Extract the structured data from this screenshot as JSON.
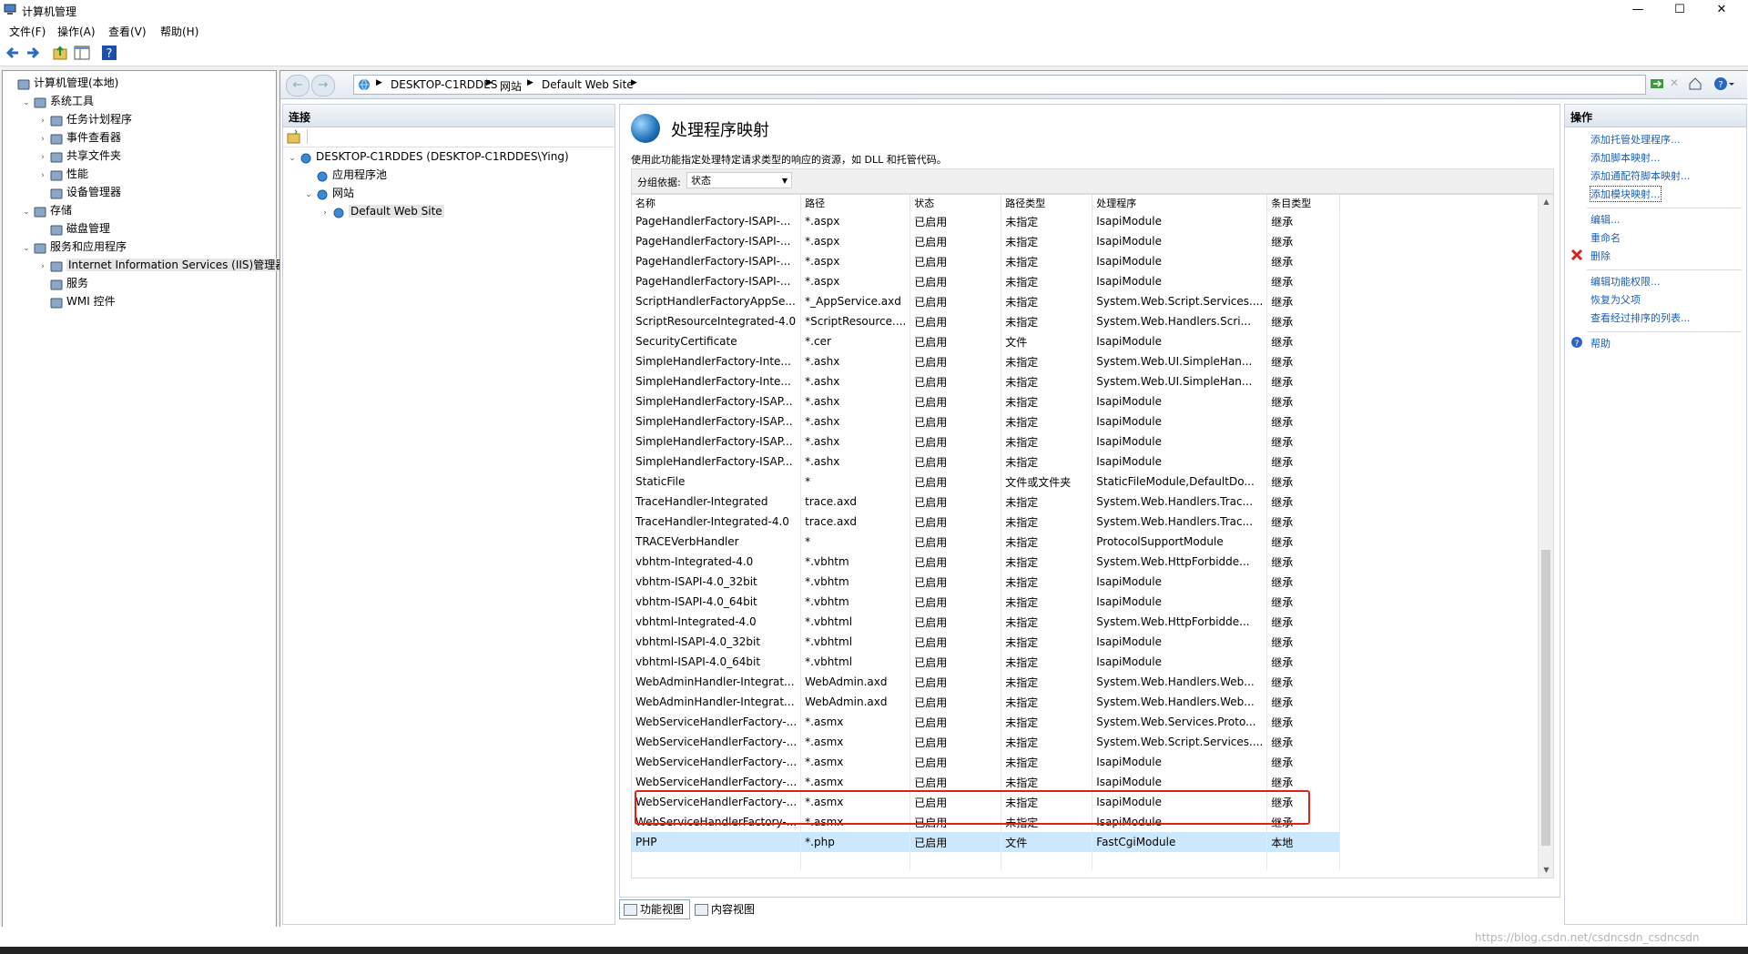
{
  "window": {
    "title": "计算机管理",
    "min": "—",
    "max": "☐",
    "close": "✕"
  },
  "menu": [
    "文件(F)",
    "操作(A)",
    "查看(V)",
    "帮助(H)"
  ],
  "tree": [
    {
      "label": "计算机管理(本地)",
      "indent": 0,
      "tw": "",
      "icon": "computer-icon"
    },
    {
      "label": "系统工具",
      "indent": 1,
      "tw": "⌄",
      "icon": "tools-icon"
    },
    {
      "label": "任务计划程序",
      "indent": 2,
      "tw": "›",
      "icon": "clock-icon"
    },
    {
      "label": "事件查看器",
      "indent": 2,
      "tw": "›",
      "icon": "event-icon"
    },
    {
      "label": "共享文件夹",
      "indent": 2,
      "tw": "›",
      "icon": "folder-icon"
    },
    {
      "label": "性能",
      "indent": 2,
      "tw": "›",
      "icon": "performance-icon"
    },
    {
      "label": "设备管理器",
      "indent": 2,
      "tw": "",
      "icon": "device-icon"
    },
    {
      "label": "存储",
      "indent": 1,
      "tw": "⌄",
      "icon": "storage-icon"
    },
    {
      "label": "磁盘管理",
      "indent": 2,
      "tw": "",
      "icon": "disk-icon"
    },
    {
      "label": "服务和应用程序",
      "indent": 1,
      "tw": "⌄",
      "icon": "services-icon"
    },
    {
      "label": "Internet Information Services (IIS)管理器",
      "indent": 2,
      "tw": "›",
      "icon": "iis-icon",
      "selected": true
    },
    {
      "label": "服务",
      "indent": 2,
      "tw": "",
      "icon": "gear-icon"
    },
    {
      "label": "WMI 控件",
      "indent": 2,
      "tw": "",
      "icon": "wmi-icon"
    }
  ],
  "address": {
    "crumbs": [
      "DESKTOP-C1RDDES",
      "网站",
      "Default Web Site"
    ]
  },
  "connections": {
    "header": "连接",
    "tree": [
      {
        "label": "DESKTOP-C1RDDES (DESKTOP-C1RDDES\\Ying)",
        "indent": 0,
        "tw": "⌄"
      },
      {
        "label": "应用程序池",
        "indent": 1,
        "tw": ""
      },
      {
        "label": "网站",
        "indent": 1,
        "tw": "⌄"
      },
      {
        "label": "Default Web Site",
        "indent": 2,
        "tw": "›",
        "selected": true
      }
    ]
  },
  "feature": {
    "title": "处理程序映射",
    "description": "使用此功能指定处理特定请求类型的响应的资源，如 DLL 和托管代码。",
    "group_label": "分组依据:",
    "group_value": "状态",
    "columns": [
      "名称",
      "路径",
      "状态",
      "路径类型",
      "处理程序",
      "条目类型"
    ],
    "rows": [
      [
        "PageHandlerFactory-ISAPI-...",
        "*.aspx",
        "已启用",
        "未指定",
        "IsapiModule",
        "继承"
      ],
      [
        "PageHandlerFactory-ISAPI-...",
        "*.aspx",
        "已启用",
        "未指定",
        "IsapiModule",
        "继承"
      ],
      [
        "PageHandlerFactory-ISAPI-...",
        "*.aspx",
        "已启用",
        "未指定",
        "IsapiModule",
        "继承"
      ],
      [
        "PageHandlerFactory-ISAPI-...",
        "*.aspx",
        "已启用",
        "未指定",
        "IsapiModule",
        "继承"
      ],
      [
        "ScriptHandlerFactoryAppSe...",
        "*_AppService.axd",
        "已启用",
        "未指定",
        "System.Web.Script.Services....",
        "继承"
      ],
      [
        "ScriptResourceIntegrated-4.0",
        "*ScriptResource....",
        "已启用",
        "未指定",
        "System.Web.Handlers.Scri...",
        "继承"
      ],
      [
        "SecurityCertificate",
        "*.cer",
        "已启用",
        "文件",
        "IsapiModule",
        "继承"
      ],
      [
        "SimpleHandlerFactory-Inte...",
        "*.ashx",
        "已启用",
        "未指定",
        "System.Web.UI.SimpleHan...",
        "继承"
      ],
      [
        "SimpleHandlerFactory-Inte...",
        "*.ashx",
        "已启用",
        "未指定",
        "System.Web.UI.SimpleHan...",
        "继承"
      ],
      [
        "SimpleHandlerFactory-ISAP...",
        "*.ashx",
        "已启用",
        "未指定",
        "IsapiModule",
        "继承"
      ],
      [
        "SimpleHandlerFactory-ISAP...",
        "*.ashx",
        "已启用",
        "未指定",
        "IsapiModule",
        "继承"
      ],
      [
        "SimpleHandlerFactory-ISAP...",
        "*.ashx",
        "已启用",
        "未指定",
        "IsapiModule",
        "继承"
      ],
      [
        "SimpleHandlerFactory-ISAP...",
        "*.ashx",
        "已启用",
        "未指定",
        "IsapiModule",
        "继承"
      ],
      [
        "StaticFile",
        "*",
        "已启用",
        "文件或文件夹",
        "StaticFileModule,DefaultDo...",
        "继承"
      ],
      [
        "TraceHandler-Integrated",
        "trace.axd",
        "已启用",
        "未指定",
        "System.Web.Handlers.Trac...",
        "继承"
      ],
      [
        "TraceHandler-Integrated-4.0",
        "trace.axd",
        "已启用",
        "未指定",
        "System.Web.Handlers.Trac...",
        "继承"
      ],
      [
        "TRACEVerbHandler",
        "*",
        "已启用",
        "未指定",
        "ProtocolSupportModule",
        "继承"
      ],
      [
        "vbhtm-Integrated-4.0",
        "*.vbhtm",
        "已启用",
        "未指定",
        "System.Web.HttpForbidde...",
        "继承"
      ],
      [
        "vbhtm-ISAPI-4.0_32bit",
        "*.vbhtm",
        "已启用",
        "未指定",
        "IsapiModule",
        "继承"
      ],
      [
        "vbhtm-ISAPI-4.0_64bit",
        "*.vbhtm",
        "已启用",
        "未指定",
        "IsapiModule",
        "继承"
      ],
      [
        "vbhtml-Integrated-4.0",
        "*.vbhtml",
        "已启用",
        "未指定",
        "System.Web.HttpForbidde...",
        "继承"
      ],
      [
        "vbhtml-ISAPI-4.0_32bit",
        "*.vbhtml",
        "已启用",
        "未指定",
        "IsapiModule",
        "继承"
      ],
      [
        "vbhtml-ISAPI-4.0_64bit",
        "*.vbhtml",
        "已启用",
        "未指定",
        "IsapiModule",
        "继承"
      ],
      [
        "WebAdminHandler-Integrat...",
        "WebAdmin.axd",
        "已启用",
        "未指定",
        "System.Web.Handlers.Web...",
        "继承"
      ],
      [
        "WebAdminHandler-Integrat...",
        "WebAdmin.axd",
        "已启用",
        "未指定",
        "System.Web.Handlers.Web...",
        "继承"
      ],
      [
        "WebServiceHandlerFactory-...",
        "*.asmx",
        "已启用",
        "未指定",
        "System.Web.Services.Proto...",
        "继承"
      ],
      [
        "WebServiceHandlerFactory-...",
        "*.asmx",
        "已启用",
        "未指定",
        "System.Web.Script.Services....",
        "继承"
      ],
      [
        "WebServiceHandlerFactory-...",
        "*.asmx",
        "已启用",
        "未指定",
        "IsapiModule",
        "继承"
      ],
      [
        "WebServiceHandlerFactory-...",
        "*.asmx",
        "已启用",
        "未指定",
        "IsapiModule",
        "继承"
      ],
      [
        "WebServiceHandlerFactory-...",
        "*.asmx",
        "已启用",
        "未指定",
        "IsapiModule",
        "继承"
      ],
      [
        "WebServiceHandlerFactory-...",
        "*.asmx",
        "已启用",
        "未指定",
        "IsapiModule",
        "继承"
      ],
      [
        "PHP",
        "*.php",
        "已启用",
        "文件",
        "FastCgiModule",
        "本地"
      ]
    ],
    "highlight_color": "#e0201a"
  },
  "view_tabs": [
    "功能视图",
    "内容视图"
  ],
  "actions": {
    "header": "操作",
    "items": [
      {
        "label": "添加托管处理程序...",
        "icon": ""
      },
      {
        "label": "添加脚本映射...",
        "icon": ""
      },
      {
        "label": "添加通配符脚本映射...",
        "icon": ""
      },
      {
        "label": "添加模块映射...",
        "icon": "",
        "selected": true
      },
      {
        "sep": true
      },
      {
        "label": "编辑...",
        "icon": ""
      },
      {
        "label": "重命名",
        "icon": ""
      },
      {
        "label": "删除",
        "icon": "delete-icon"
      },
      {
        "sep": true
      },
      {
        "label": "编辑功能权限...",
        "icon": ""
      },
      {
        "label": "恢复为父项",
        "icon": ""
      },
      {
        "label": "查看经过排序的列表...",
        "icon": ""
      },
      {
        "sep": true
      },
      {
        "label": "帮助",
        "icon": "help-icon"
      }
    ]
  },
  "watermark": "https://blog.csdn.net/csdncsdn_csdncsdn",
  "colors": {
    "accent": "#1a5fb4",
    "highlight_row": "#cce8ff"
  }
}
